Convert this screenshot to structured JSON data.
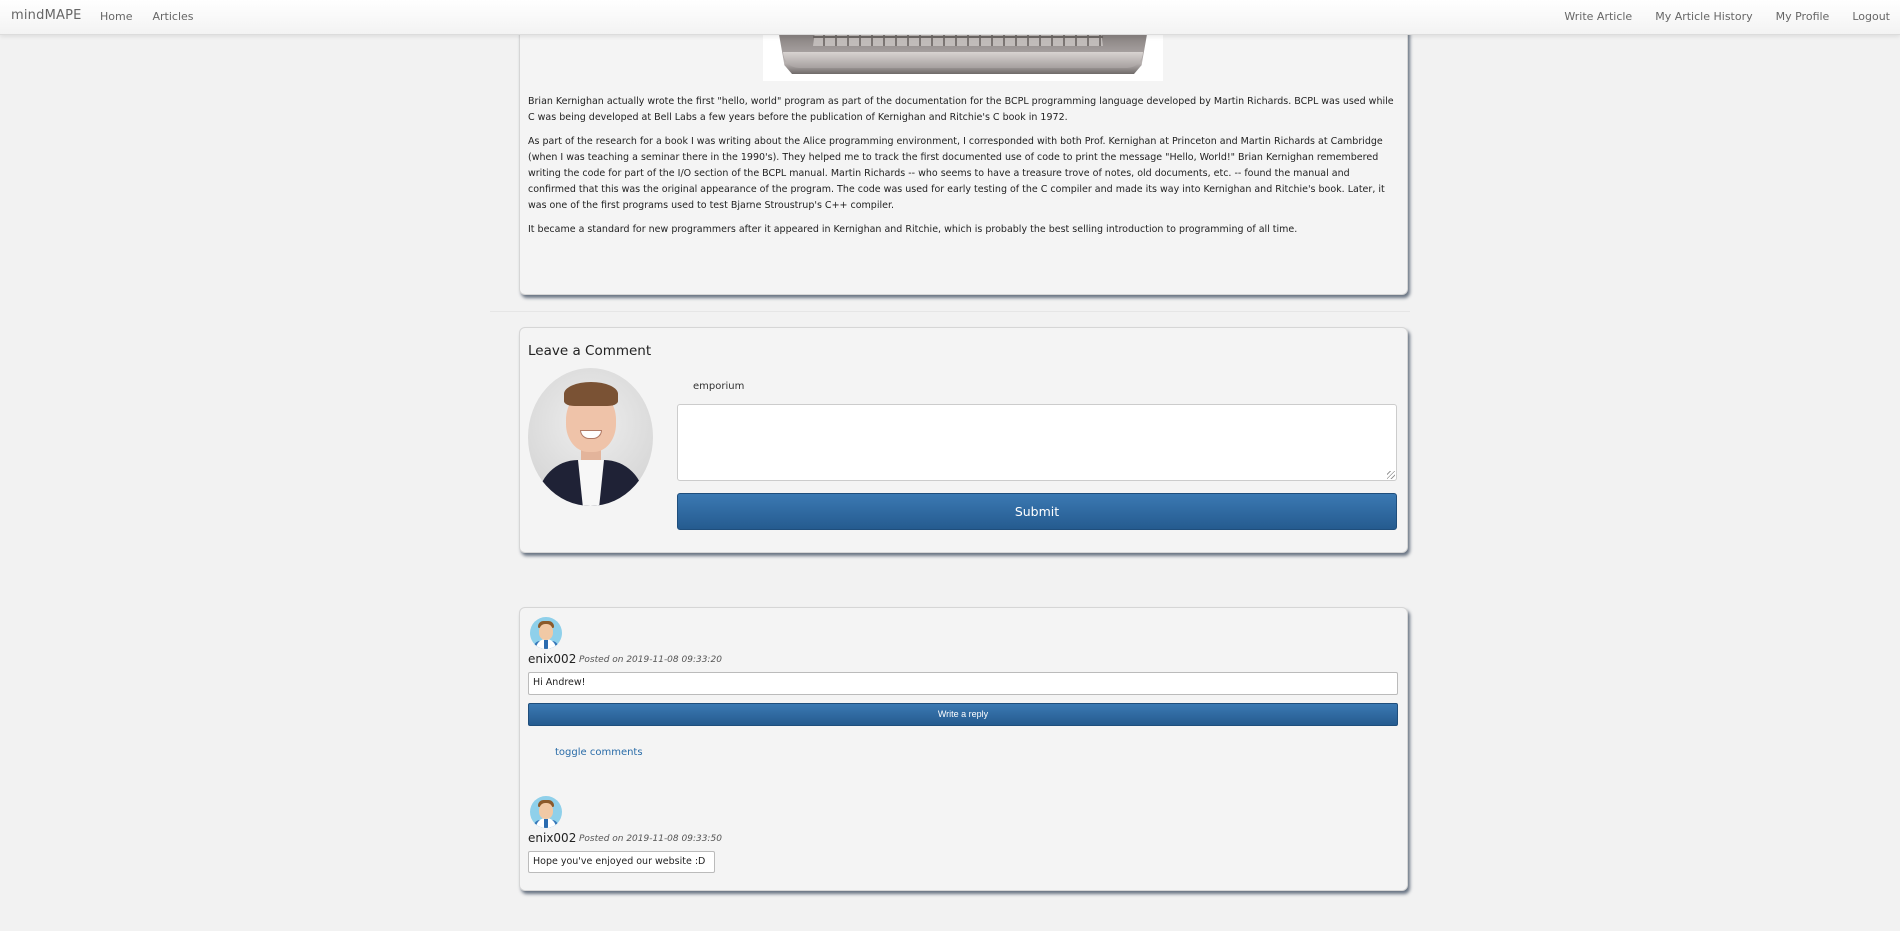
{
  "navbar": {
    "brand": "mindMAPE",
    "left_links": [
      "Home",
      "Articles"
    ],
    "right_links": [
      "Write Article",
      "My Article History",
      "My Profile",
      "Logout"
    ]
  },
  "article": {
    "paragraphs": [
      "Brian Kernighan actually wrote the first \"hello, world\" program as part of the documentation for the BCPL programming language developed by Martin Richards. BCPL was used while C was being developed at Bell Labs a few years before the publication of Kernighan and Ritchie's C book in 1972.",
      "As part of the research for a book I was writing about the Alice programming environment, I corresponded with both Prof. Kernighan at Princeton and Martin Richards at Cambridge (when I was teaching a seminar there in the 1990's). They helped me to track the first documented use of code to print the message \"Hello, World!\" Brian Kernighan remembered writing the code for part of the I/O section of the BCPL manual. Martin Richards -- who seems to have a treasure trove of notes, old documents, etc. -- found the manual and confirmed that this was the original appearance of the program. The code was used for early testing of the C compiler and made its way into Kernighan and Ritchie's book. Later, it was one of the first programs used to test Bjarne Stroustrup's C++ compiler.",
      "It became a standard for new programmers after it appeared in Kernighan and Ritchie, which is probably the best selling introduction to programming of all time."
    ]
  },
  "comment_form": {
    "heading": "Leave a Comment",
    "username": "emporium",
    "textarea_value": "",
    "submit_label": "Submit"
  },
  "comments": [
    {
      "author": "enix002",
      "posted": "Posted on 2019-11-08 09:33:20",
      "text": "Hi Andrew!",
      "reply_label": "Write a reply",
      "toggle_label": "toggle comments"
    },
    {
      "author": "enix002",
      "posted": "Posted on 2019-11-08 09:33:50",
      "text": "Hope you've enjoyed our website :D"
    }
  ]
}
